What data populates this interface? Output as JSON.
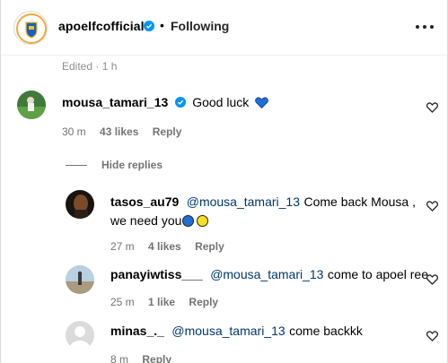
{
  "header": {
    "username": "apoelfcofficial",
    "dot": "•",
    "following": "Following",
    "more_icon": "more-horizontal-icon"
  },
  "post_meta": {
    "edited": "Edited · 1 h"
  },
  "comments": [
    {
      "username": "mousa_tamari_13",
      "verified": true,
      "text": "Good luck",
      "emoji": "blue-heart-icon",
      "time": "30 m",
      "likes": "43 likes",
      "reply": "Reply"
    }
  ],
  "hide_replies": "Hide replies",
  "replies": [
    {
      "username": "tasos_au79",
      "mention": "@mousa_tamari_13",
      "text_line1": "Come back Mousa ,",
      "text_line2": "we need you",
      "emoji": [
        "blue-circle",
        "yellow-circle"
      ],
      "time": "27 m",
      "likes": "4 likes",
      "reply": "Reply"
    },
    {
      "username": "panayiwtiss___",
      "mention": "@mousa_tamari_13",
      "text": "come to apoel ree",
      "time": "25 m",
      "likes": "1 like",
      "reply": "Reply"
    },
    {
      "username": "minas_._",
      "mention": "@mousa_tamari_13",
      "text": "come backkk",
      "time": "8 m",
      "likes": "",
      "reply": "Reply"
    }
  ],
  "colors": {
    "verified": "#0095f6",
    "mention": "#00376b",
    "meta": "#737373",
    "emoji_blue": "#1f6fd6",
    "emoji_yellow": "#f5e020"
  }
}
